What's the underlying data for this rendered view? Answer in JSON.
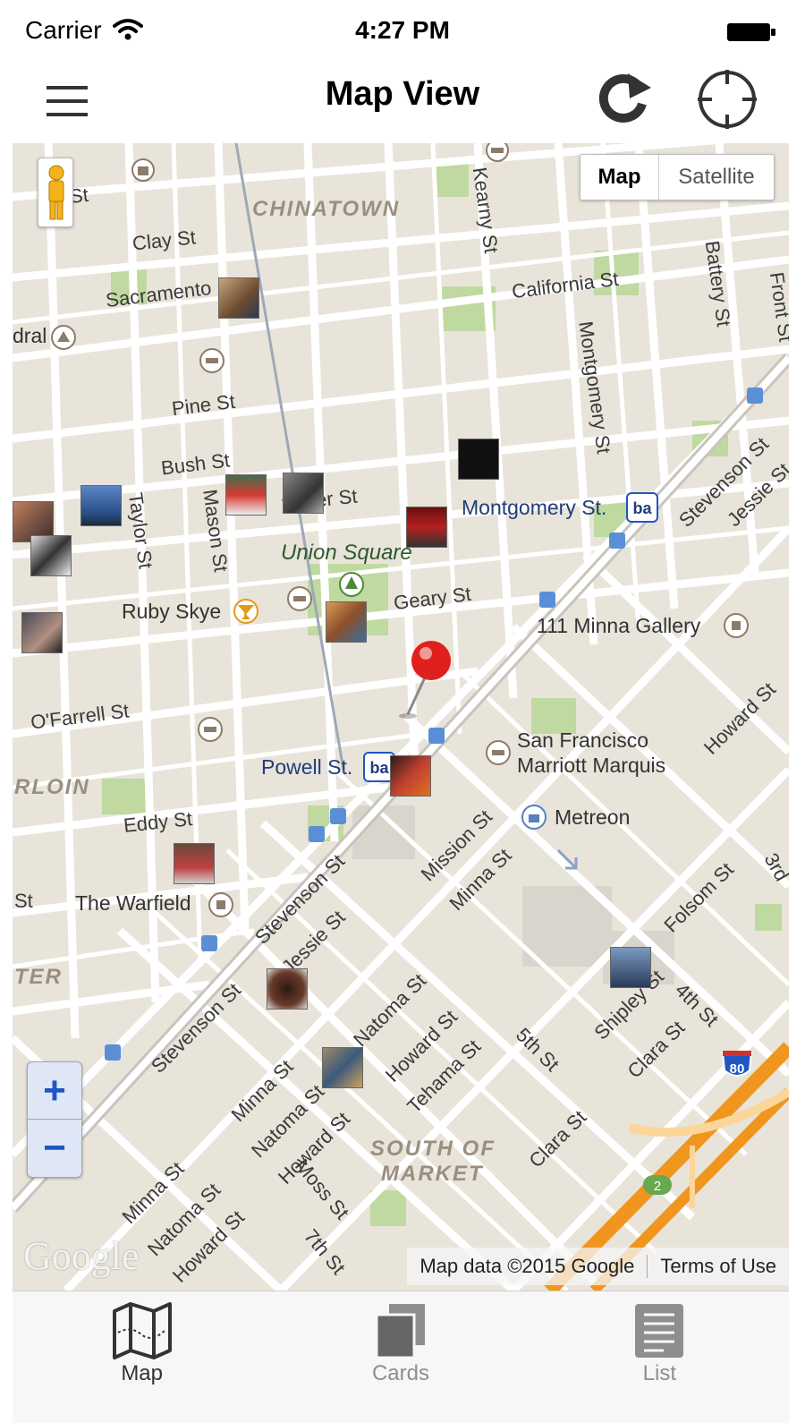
{
  "status_bar": {
    "carrier": "Carrier",
    "time": "4:27 PM",
    "wifi_icon": "wifi-icon",
    "battery_icon": "battery-icon"
  },
  "nav_bar": {
    "title": "Map View",
    "left_icon": "hamburger-menu-icon",
    "right_icons": [
      "refresh-icon",
      "crosshair-locate-icon"
    ]
  },
  "map": {
    "map_type": {
      "options": [
        "Map",
        "Satellite"
      ],
      "selected": "Map"
    },
    "zoom": {
      "in_label": "+",
      "out_label": "−"
    },
    "districts": [
      "CHINATOWN",
      "SOUTH OF",
      "MARKET",
      "RLOIN",
      "TER"
    ],
    "parks": [
      "Union Square"
    ],
    "pois": {
      "montgomery": "Montgomery St.",
      "minna_gallery": "111 Minna Gallery",
      "ruby_skye": "Ruby Skye",
      "powell": "Powell St.",
      "marriott_1": "San Francisco",
      "marriott_2": "Marriott Marquis",
      "metreon": "Metreon",
      "warfield": "The Warfield",
      "dral": "dral",
      "bart": "ba",
      "highway": "80",
      "route": "2"
    },
    "streets": {
      "clay": "Clay St",
      "sacramento": "Sacramento",
      "california": "California St",
      "pine": "Pine St",
      "bush": "Bush St",
      "sutter": "Sutter St",
      "geary": "Geary St",
      "ofarrell": "O'Farrell St",
      "eddy": "Eddy St",
      "kearny": "Kearny St",
      "montgomery_st": "Montgomery St",
      "battery": "Battery St",
      "front": "Front St",
      "taylor": "Taylor St",
      "mason": "Mason St",
      "mission": "Mission St",
      "minna": "Minna St",
      "natoma": "Natoma St",
      "howard": "Howard St",
      "tehama": "Tehama St",
      "fifth": "5th St",
      "fourth": "4th St",
      "folsom": "Folsom St",
      "shipley": "Shipley St",
      "clara": "Clara St",
      "stevenson": "Stevenson St",
      "jessie": "Jessie St",
      "moss": "Moss St",
      "seventh": "7th St",
      "st_left": "St",
      "st_left2": "St",
      "third": "3rd"
    },
    "attribution": {
      "data": "Map data ©2015 Google",
      "terms": "Terms of Use"
    },
    "logo": "Google"
  },
  "tab_bar": {
    "tabs": [
      {
        "label": "Map",
        "icon": "folded-map-icon",
        "active": true
      },
      {
        "label": "Cards",
        "icon": "stacked-cards-icon",
        "active": false
      },
      {
        "label": "List",
        "icon": "list-document-icon",
        "active": false
      }
    ]
  },
  "colors": {
    "map_background": "#e8e4da",
    "street": "#ffffff",
    "park": "#bfd9a0",
    "highway": "#f0961e",
    "pin": "#e0201c",
    "zoom_accent": "#1f56c3"
  }
}
